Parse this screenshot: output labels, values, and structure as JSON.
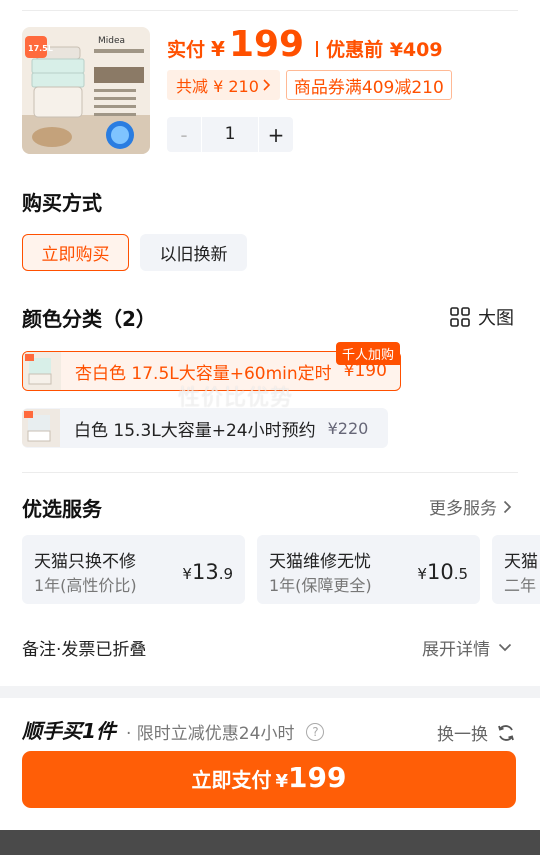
{
  "product": {
    "price_label": "实付",
    "price_currency": "¥",
    "price_value": "199",
    "original_label": "优惠前 ¥409",
    "save_tag": "共减 ¥ 210",
    "coupon_tag": "商品券满409减210",
    "image_brand": "Midea",
    "image_capacity": "17.5L",
    "quantity": "1",
    "minus": "-",
    "plus": "+"
  },
  "purchase_method": {
    "title": "购买方式",
    "options": [
      "立即购买",
      "以旧换新"
    ],
    "selected_index": 0
  },
  "color": {
    "title": "颜色分类（2）",
    "big_image_label": "大图",
    "options": [
      {
        "name": "杏白色 17.5L大容量+60min定时",
        "price": "¥190",
        "badge": "千人加购",
        "selected": true
      },
      {
        "name": "白色 15.3L大容量+24小时预约",
        "price": "¥220",
        "selected": false
      }
    ],
    "watermark": "性价比优势"
  },
  "services": {
    "title": "优选服务",
    "more_label": "更多服务",
    "items": [
      {
        "name": "天猫只换不修",
        "desc": "1年(高性价比)",
        "currency": "¥",
        "price_int": "13",
        "price_dec": ".9"
      },
      {
        "name": "天猫维修无忧",
        "desc": "1年(保障更全)",
        "currency": "¥",
        "price_int": "10",
        "price_dec": ".5"
      },
      {
        "name": "天猫",
        "desc": "二年"
      }
    ]
  },
  "notes": {
    "label": "备注·发票已折叠",
    "expand_label": "展开详情"
  },
  "addon": {
    "title": "顺手买1件",
    "subtitle": "· 限时立减优惠24小时",
    "swap_label": "换一换"
  },
  "pay": {
    "label": "立即支付",
    "currency": "¥",
    "amount": "199"
  },
  "colors": {
    "accent": "#ff5000",
    "pay_button": "#ff5e07"
  }
}
